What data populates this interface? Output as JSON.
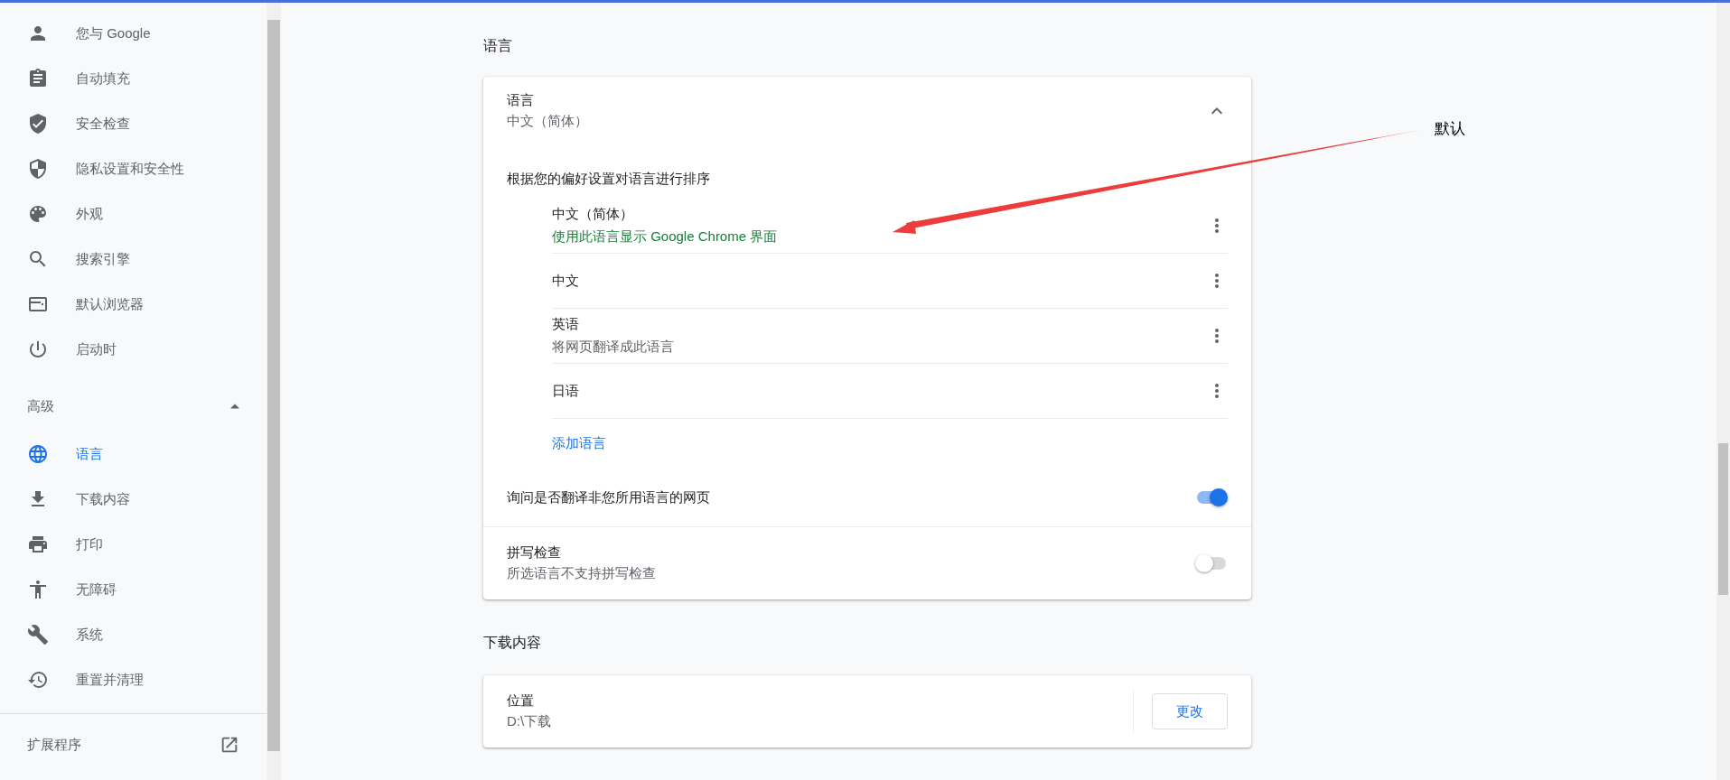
{
  "sidebar": {
    "items": [
      {
        "label": "您与 Google",
        "kind": "person",
        "selected": false
      },
      {
        "label": "自动填充",
        "kind": "clipboard",
        "selected": false
      },
      {
        "label": "安全检查",
        "kind": "shield_check",
        "selected": false
      },
      {
        "label": "隐私设置和安全性",
        "kind": "shield",
        "selected": false
      },
      {
        "label": "外观",
        "kind": "palette",
        "selected": false
      },
      {
        "label": "搜索引擎",
        "kind": "search",
        "selected": false
      },
      {
        "label": "默认浏览器",
        "kind": "window",
        "selected": false
      },
      {
        "label": "启动时",
        "kind": "power",
        "selected": false
      }
    ],
    "advanced": {
      "label": "高级",
      "expanded": true
    },
    "advanced_items": [
      {
        "label": "语言",
        "kind": "globe",
        "selected": true
      },
      {
        "label": "下载内容",
        "kind": "download",
        "selected": false
      },
      {
        "label": "打印",
        "kind": "printer",
        "selected": false
      },
      {
        "label": "无障碍",
        "kind": "accessibility",
        "selected": false
      },
      {
        "label": "系统",
        "kind": "wrench",
        "selected": false
      },
      {
        "label": "重置并清理",
        "kind": "history",
        "selected": false
      }
    ],
    "extensions": {
      "label": "扩展程序"
    }
  },
  "languages_section": {
    "heading": "语言",
    "language_panel": {
      "title": "语言",
      "value": "中文（简体）",
      "expanded": true
    },
    "order_hint": "根据您的偏好设置对语言进行排序",
    "languages": [
      {
        "name": "中文（简体）",
        "note": "使用此语言显示 Google Chrome 界面",
        "kind": "ui"
      },
      {
        "name": "中文"
      },
      {
        "name": "英语",
        "note": "将网页翻译成此语言",
        "kind": "plain"
      },
      {
        "name": "日语"
      }
    ],
    "add_language": "添加语言",
    "toggles": [
      {
        "label": "询问是否翻译非您所用语言的网页",
        "on": true
      },
      {
        "label": "拼写检查",
        "description": "所选语言不支持拼写检查",
        "on": false
      }
    ]
  },
  "downloads_section": {
    "heading": "下载内容",
    "location": {
      "label": "位置",
      "value": "D:\\下载",
      "button": "更改"
    }
  },
  "annotation": {
    "label": "默认"
  }
}
